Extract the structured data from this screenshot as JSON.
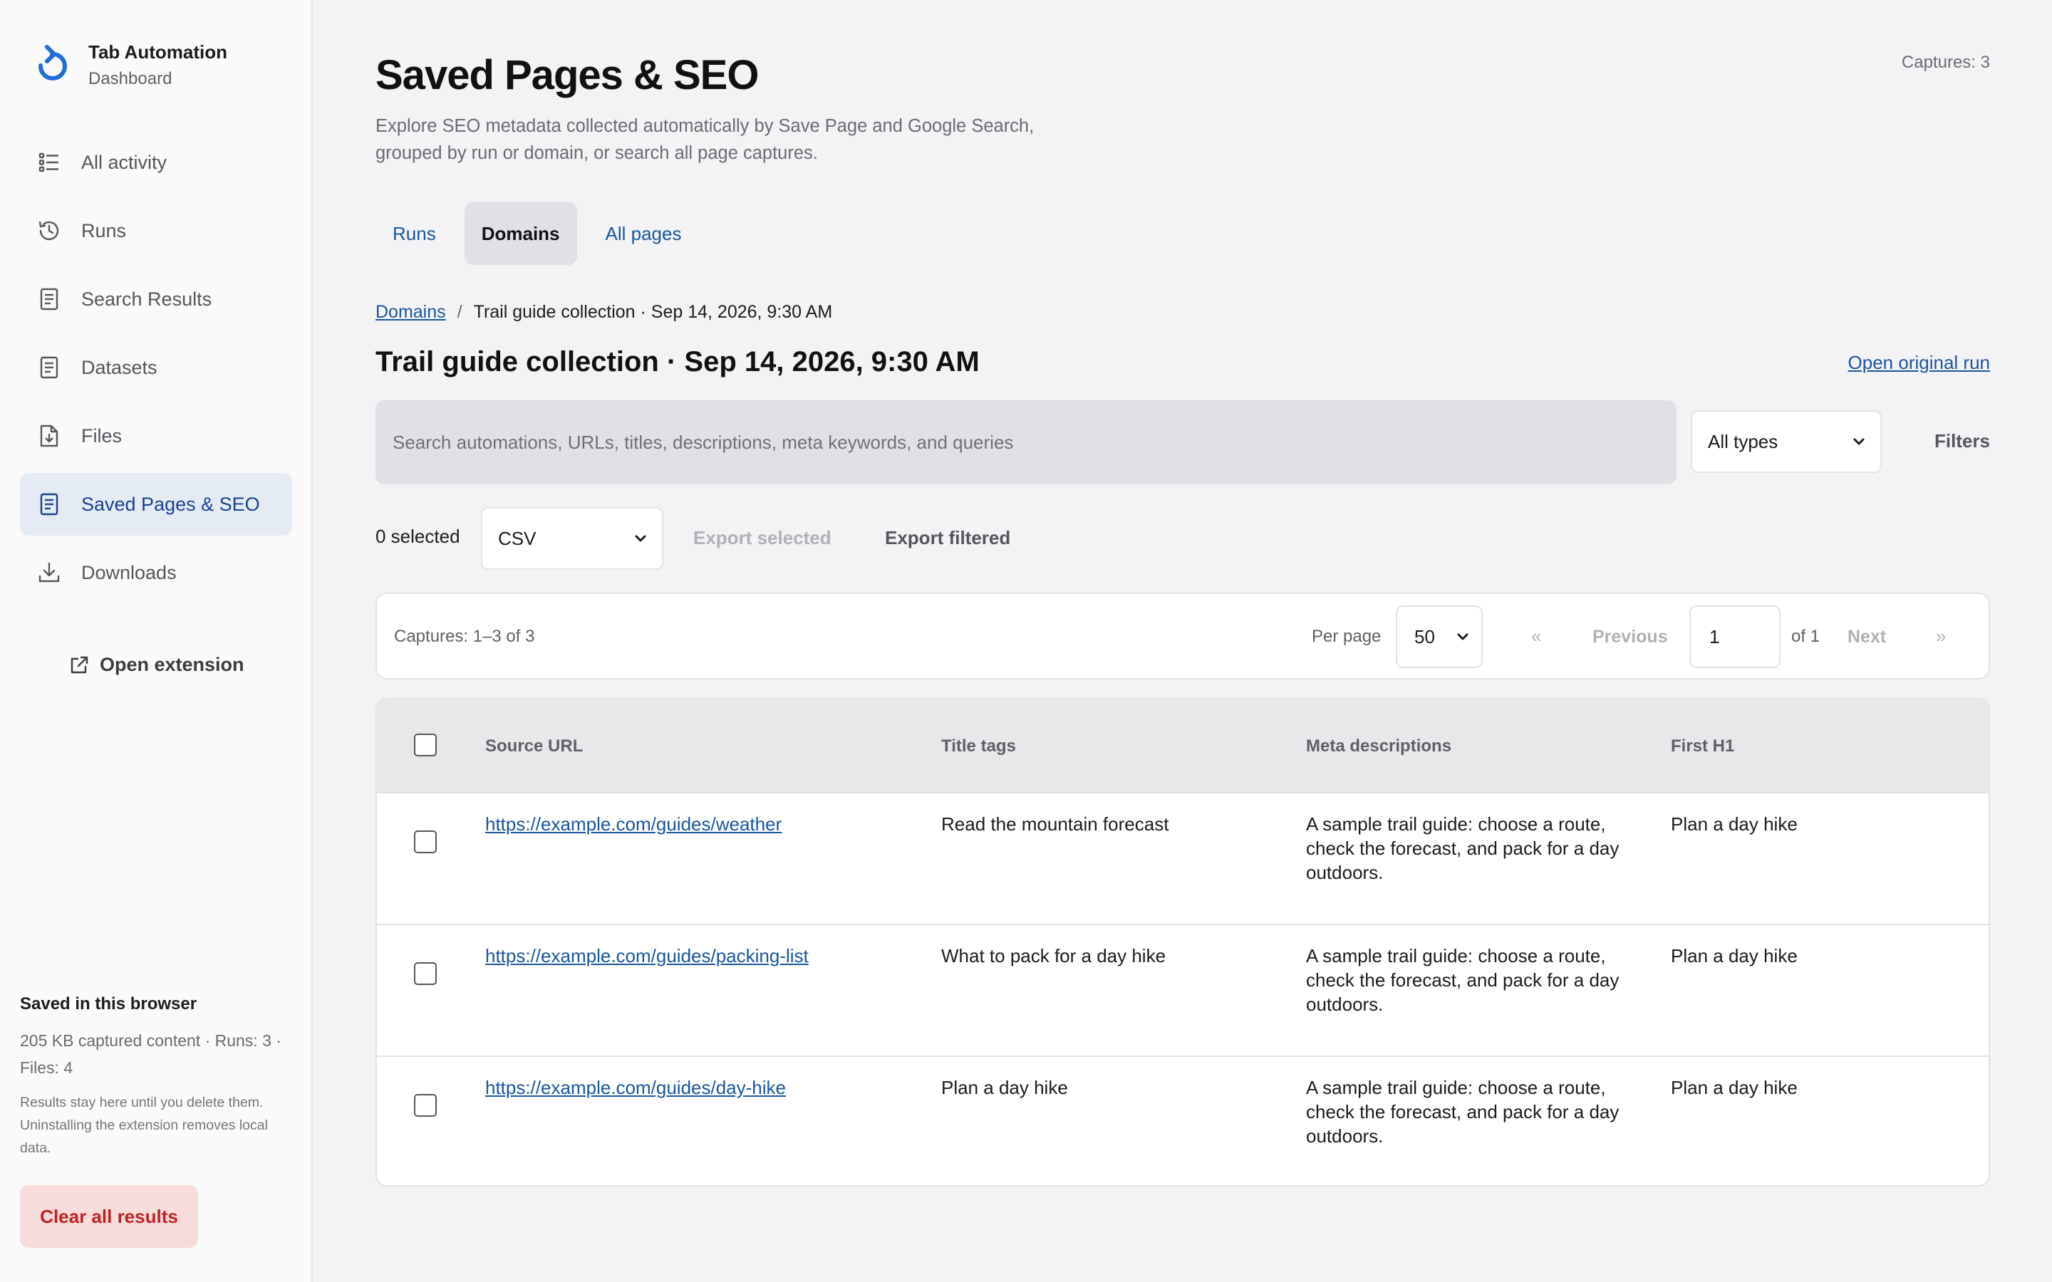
{
  "app": {
    "title": "Tab Automation",
    "subtitle": "Dashboard"
  },
  "sidebar": {
    "items": [
      {
        "label": "All activity",
        "icon": "list-icon",
        "active": false
      },
      {
        "label": "Runs",
        "icon": "history-icon",
        "active": false
      },
      {
        "label": "Search Results",
        "icon": "document-icon",
        "active": false
      },
      {
        "label": "Datasets",
        "icon": "document-icon",
        "active": false
      },
      {
        "label": "Files",
        "icon": "file-download-icon",
        "active": false
      },
      {
        "label": "Saved Pages & SEO",
        "icon": "document-icon",
        "active": true
      },
      {
        "label": "Downloads",
        "icon": "download-icon",
        "active": false
      }
    ],
    "open_extension": "Open extension",
    "storage": {
      "title": "Saved in this browser",
      "stats": "205 KB captured content · Runs: 3 · Files: 4",
      "note": "Results stay here until you delete them. Uninstalling the extension removes local data."
    },
    "clear_button": "Clear all results"
  },
  "header": {
    "title": "Saved Pages & SEO",
    "description": "Explore SEO metadata collected automatically by Save Page and Google Search, grouped by run or domain, or search all page captures.",
    "captures_count": "Captures: 3"
  },
  "tabs": [
    {
      "label": "Runs",
      "active": false
    },
    {
      "label": "Domains",
      "active": true
    },
    {
      "label": "All pages",
      "active": false
    }
  ],
  "breadcrumb": {
    "root": "Domains",
    "separator": "/",
    "current": "Trail guide collection · Sep 14, 2026, 9:30 AM"
  },
  "run": {
    "title": "Trail guide collection · Sep 14, 2026, 9:30 AM",
    "open_original": "Open original run"
  },
  "search": {
    "placeholder": "Search automations, URLs, titles, descriptions, meta keywords, and queries",
    "type_selected": "All types",
    "filters_label": "Filters"
  },
  "export": {
    "selected_count": "0 selected",
    "format_selected": "CSV",
    "export_selected": "Export selected",
    "export_filtered": "Export filtered"
  },
  "pagination": {
    "info": "Captures: 1–3 of 3",
    "per_page_label": "Per page",
    "per_page_value": "50",
    "first": "«",
    "previous": "Previous",
    "page": "1",
    "of": "of 1",
    "next": "Next",
    "last": "»"
  },
  "table": {
    "columns": [
      "Source URL",
      "Title tags",
      "Meta descriptions",
      "First H1"
    ],
    "rows": [
      {
        "url": "https://example.com/guides/weather",
        "title": "Read the mountain forecast",
        "description": "A sample trail guide: choose a route, check the forecast, and pack for a day outdoors.",
        "h1": "Plan a day hike"
      },
      {
        "url": "https://example.com/guides/packing-list",
        "title": "What to pack for a day hike",
        "description": "A sample trail guide: choose a route, check the forecast, and pack for a day outdoors.",
        "h1": "Plan a day hike"
      },
      {
        "url": "https://example.com/guides/day-hike",
        "title": "Plan a day hike",
        "description": "A sample trail guide: choose a route, check the forecast, and pack for a day outdoors.",
        "h1": "Plan a day hike"
      }
    ]
  },
  "colors": {
    "accent": "#18569e",
    "active_nav_bg": "#e4ebf5",
    "danger": "#bd2424",
    "danger_bg": "#f8dcdc"
  }
}
